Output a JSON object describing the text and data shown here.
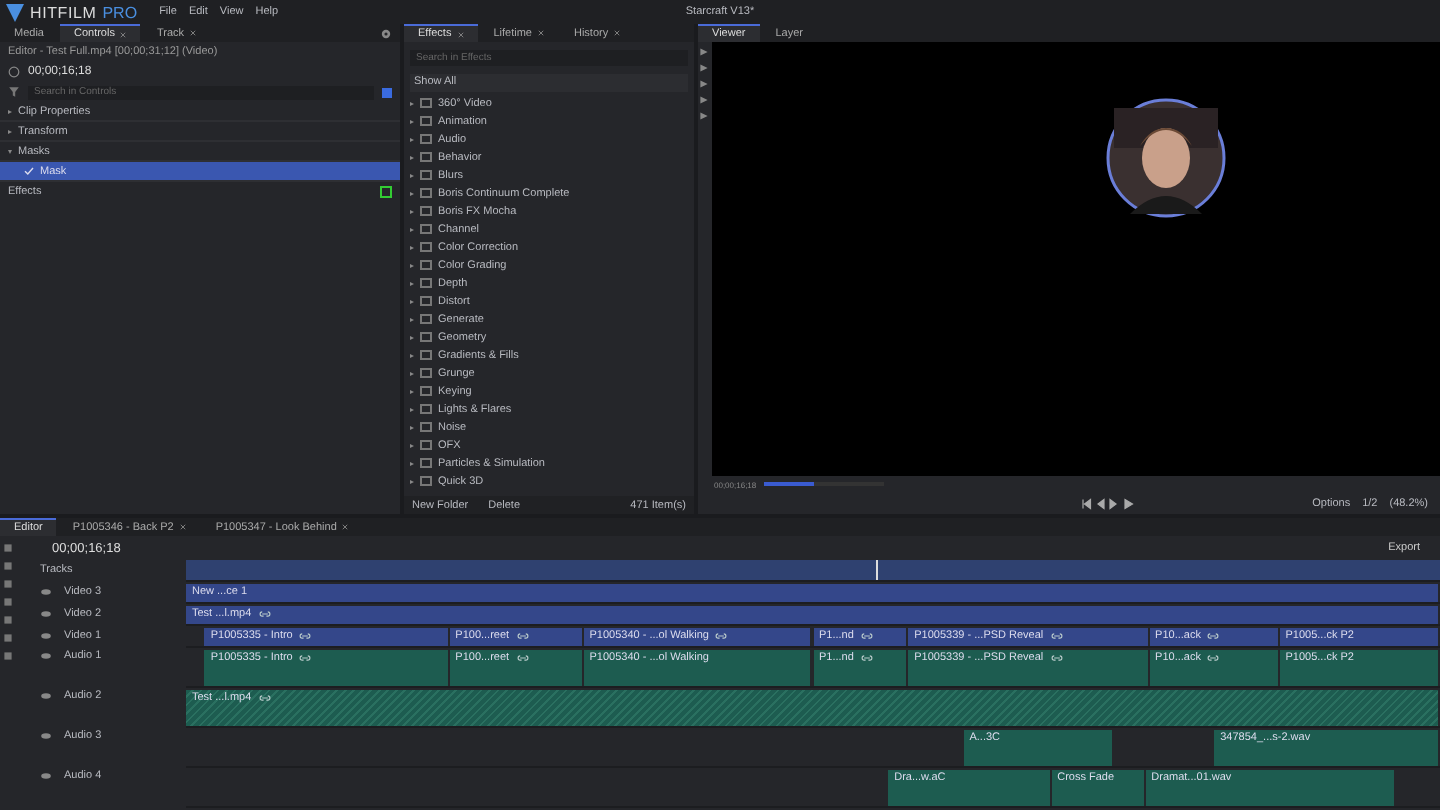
{
  "app": {
    "logo": "HITFILM",
    "edition": "PRO",
    "menu": [
      "File",
      "Edit",
      "View",
      "Help"
    ],
    "title": "Starcraft V13*"
  },
  "controls_panel": {
    "tabs": [
      {
        "label": "Media",
        "selected": false,
        "closable": false
      },
      {
        "label": "Controls",
        "selected": true,
        "closable": true
      },
      {
        "label": "Track",
        "selected": false,
        "closable": true
      }
    ],
    "header": "Editor - Test Full.mp4 [00;00;31;12] (Video)",
    "timecode": "00;00;16;18",
    "search": {
      "placeholder": "Search in Controls"
    },
    "tree": [
      {
        "label": "Clip Properties",
        "expanded": false
      },
      {
        "label": "Transform",
        "expanded": false
      },
      {
        "label": "Masks",
        "expanded": true,
        "children": [
          {
            "label": "Mask",
            "checked": true,
            "selected": true
          }
        ]
      }
    ],
    "effects_label": "Effects"
  },
  "effects_panel": {
    "tabs": [
      {
        "label": "Effects",
        "selected": true
      },
      {
        "label": "Lifetime",
        "selected": false
      },
      {
        "label": "History",
        "selected": false
      }
    ],
    "search": {
      "placeholder": "Search in Effects"
    },
    "filter": "Show All",
    "folders": [
      "360° Video",
      "Animation",
      "Audio",
      "Behavior",
      "Blurs",
      "Boris Continuum Complete",
      "Boris FX Mocha",
      "Channel",
      "Color Correction",
      "Color Grading",
      "Depth",
      "Distort",
      "Generate",
      "Geometry",
      "Gradients & Fills",
      "Grunge",
      "Keying",
      "Lights & Flares",
      "Noise",
      "OFX",
      "Particles & Simulation",
      "Quick 3D"
    ],
    "footer": {
      "new_folder": "New Folder",
      "delete": "Delete",
      "count": "471 Item(s)"
    }
  },
  "viewer": {
    "tabs": [
      {
        "label": "Viewer",
        "selected": true
      },
      {
        "label": "Layer",
        "selected": false
      }
    ],
    "timecode": "00;00;16;18",
    "scrub": {
      "level": 0.42
    },
    "options": "Options",
    "resolution": "1/2",
    "zoom": "(48.2%)"
  },
  "timeline": {
    "tabs": [
      {
        "label": "Editor",
        "selected": true,
        "closable": false
      },
      {
        "label": "P1005346 - Back P2",
        "selected": false,
        "closable": true
      },
      {
        "label": "P1005347 - Look Behind",
        "selected": false,
        "closable": true
      }
    ],
    "timecode": "00;00;16;18",
    "export": "Export",
    "tracks_label": "Tracks",
    "playhead": {
      "level": 0.55
    },
    "tracks": [
      {
        "name": "Video 3",
        "kind": "video",
        "clips": [
          {
            "label": "New ...ce 1",
            "linked": false
          }
        ]
      },
      {
        "name": "Video 2",
        "kind": "video",
        "clips": [
          {
            "label": "Test ...l.mp4",
            "linked": true
          }
        ]
      },
      {
        "name": "Video 1",
        "kind": "video",
        "clips": [
          {
            "label": "P1005335 - Intro",
            "linked": true
          },
          {
            "label": "P100...reet",
            "linked": true
          },
          {
            "label": "P1005340 - ...ol Walking",
            "linked": true
          },
          {
            "label": "P1...nd",
            "linked": true
          },
          {
            "label": "P1005339 - ...PSD Reveal",
            "linked": true
          },
          {
            "label": "P10...ack",
            "linked": true
          },
          {
            "label": "P1005...ck P2",
            "linked": false
          }
        ]
      },
      {
        "name": "Audio 1",
        "kind": "audio",
        "clips": [
          {
            "label": "P1005335 - Intro",
            "linked": true
          },
          {
            "label": "P100...reet",
            "linked": true
          },
          {
            "label": "P1005340 - ...ol Walking",
            "linked": false
          },
          {
            "label": "P1...nd",
            "linked": true
          },
          {
            "label": "P1005339 - ...PSD Reveal",
            "linked": true
          },
          {
            "label": "P10...ack",
            "linked": true
          },
          {
            "label": "P1005...ck P2",
            "linked": false
          }
        ]
      },
      {
        "name": "Audio 2",
        "kind": "audio",
        "clips": [
          {
            "label": "Test ...l.mp4",
            "linked": true
          }
        ]
      },
      {
        "name": "Audio 3",
        "kind": "audio",
        "clips": [
          {
            "label": "A...3C",
            "linked": false
          },
          {
            "label": "347854_...s-2.wav",
            "linked": false
          }
        ]
      },
      {
        "name": "Audio 4",
        "kind": "audio",
        "clips": [
          {
            "label": "Dra...w.aC",
            "linked": false
          },
          {
            "label": "Cross Fade",
            "linked": false
          },
          {
            "label": "Dramat...01.wav",
            "linked": false
          }
        ]
      }
    ]
  }
}
